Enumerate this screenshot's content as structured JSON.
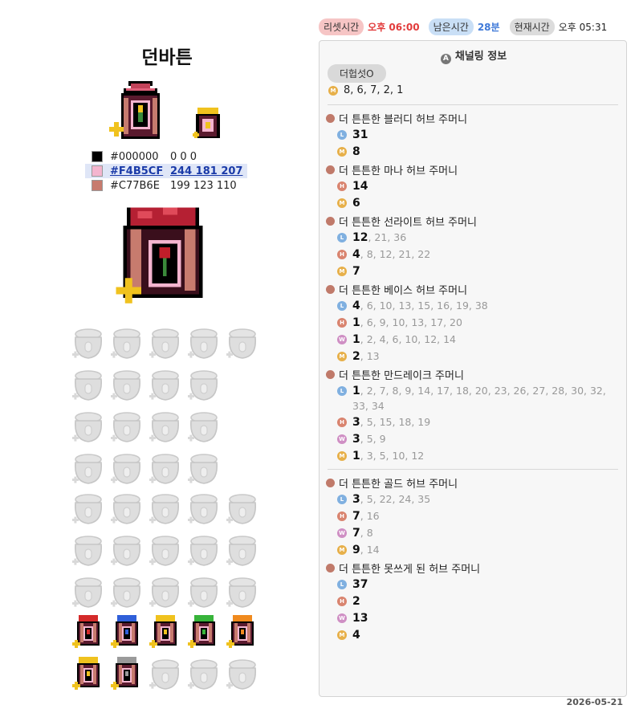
{
  "title": "던바튼",
  "header": {
    "reset_label": "리셋시간",
    "reset_value": "오후 06:00",
    "remain_label": "남은시간",
    "remain_value": "28분",
    "now_label": "현재시간",
    "now_value": "오후 05:31"
  },
  "swatches": [
    {
      "hex": "#000000",
      "rgb": "0 0 0",
      "color": "#000000"
    },
    {
      "hex": "#F4B5CF",
      "rgb": "244 181 207",
      "color": "#F4B5CF"
    },
    {
      "hex": "#C77B6E",
      "rgb": "199 123 110",
      "color": "#C77B6E"
    }
  ],
  "panel": {
    "title": "채널링 정보",
    "title_icon": "a-icon",
    "selector": "더헙섯O",
    "top_badge": "M",
    "top_values": "8, 6, 7, 2, 1"
  },
  "pouches": [
    {
      "name": "더 튼튼한 블러디 허브 주머니",
      "rows": [
        {
          "badge": "L",
          "first": "31",
          "rest": ""
        },
        {
          "badge": "M",
          "first": "8",
          "rest": ""
        }
      ]
    },
    {
      "name": "더 튼튼한 마나 허브 주머니",
      "rows": [
        {
          "badge": "H",
          "first": "14",
          "rest": ""
        },
        {
          "badge": "M",
          "first": "6",
          "rest": ""
        }
      ]
    },
    {
      "name": "더 튼튼한 선라이트 허브 주머니",
      "rows": [
        {
          "badge": "L",
          "first": "12",
          "rest": ", 21, 36"
        },
        {
          "badge": "H",
          "first": "4",
          "rest": ", 8, 12, 21, 22"
        },
        {
          "badge": "M",
          "first": "7",
          "rest": ""
        }
      ]
    },
    {
      "name": "더 튼튼한 베이스 허브 주머니",
      "rows": [
        {
          "badge": "L",
          "first": "4",
          "rest": ", 6, 10, 13, 15, 16, 19, 38"
        },
        {
          "badge": "H",
          "first": "1",
          "rest": ", 6, 9, 10, 13, 17, 20"
        },
        {
          "badge": "W",
          "first": "1",
          "rest": ", 2, 4, 6, 10, 12, 14"
        },
        {
          "badge": "M",
          "first": "2",
          "rest": ", 13"
        }
      ]
    },
    {
      "name": "더 튼튼한 만드레이크 주머니",
      "rows": [
        {
          "badge": "L",
          "first": "1",
          "rest": ", 2, 7, 8, 9, 14, 17, 18, 20, 23, 26, 27, 28, 30, 32, 33, 34"
        },
        {
          "badge": "H",
          "first": "3",
          "rest": ", 5, 15, 18, 19"
        },
        {
          "badge": "W",
          "first": "3",
          "rest": ", 5, 9"
        },
        {
          "badge": "M",
          "first": "1",
          "rest": ", 3, 5, 10, 12"
        }
      ]
    },
    {
      "name": "더 튼튼한 골드 허브 주머니",
      "rows": [
        {
          "badge": "L",
          "first": "3",
          "rest": ", 5, 22, 24, 35"
        },
        {
          "badge": "H",
          "first": "7",
          "rest": ", 16"
        },
        {
          "badge": "W",
          "first": "7",
          "rest": ", 8"
        },
        {
          "badge": "M",
          "first": "9",
          "rest": ", 14"
        }
      ]
    },
    {
      "name": "더 튼튼한 못쓰게 된 허브 주머니",
      "rows": [
        {
          "badge": "L",
          "first": "37",
          "rest": ""
        },
        {
          "badge": "H",
          "first": "2",
          "rest": ""
        },
        {
          "badge": "W",
          "first": "13",
          "rest": ""
        },
        {
          "badge": "M",
          "first": "4",
          "rest": ""
        }
      ]
    }
  ],
  "grid": {
    "icon_names": [
      "egg-basket",
      "vegetable-basket",
      "wheat-basket",
      "grain-basket",
      "stalk-basket",
      "meat-pouch",
      "sparkle-pouch",
      "carrot-pouch",
      "corn-pouch",
      "cloth-bag-1",
      "cloth-bag-2",
      "cloth-bag-3",
      "cloth-bag-4",
      "grey-bag-1",
      "grey-bag-2",
      "grey-bag-3",
      "grey-bag-4",
      "bread-bag-1",
      "bread-bag-2",
      "bread-bag-3",
      "bread-bag-4",
      "fruit-basket",
      "gem-pouch-1",
      "gem-pouch-2",
      "gem-pouch-3",
      "gem-pouch-4",
      "gem-pouch-5",
      "gem-pouch-6",
      "gem-pouch-7",
      "gem-pouch-8",
      "gem-pouch-9",
      "gem-pouch-10",
      "red-herb-pouch",
      "blue-herb-pouch",
      "yellow-herb-pouch",
      "green-herb-pouch",
      "orange-herb-pouch",
      "gold-herb-pouch",
      "grey-herb-pouch",
      "faded-pouch-1",
      "faded-pouch-2",
      "faded-pouch-3"
    ],
    "herb_colors": [
      "#d42a2a",
      "#2f5fd9",
      "#f0c21e",
      "#37b43a",
      "#f08a1e",
      "#f0c21e",
      "#9a9a9a"
    ]
  },
  "footer_date": "2026-05-21"
}
